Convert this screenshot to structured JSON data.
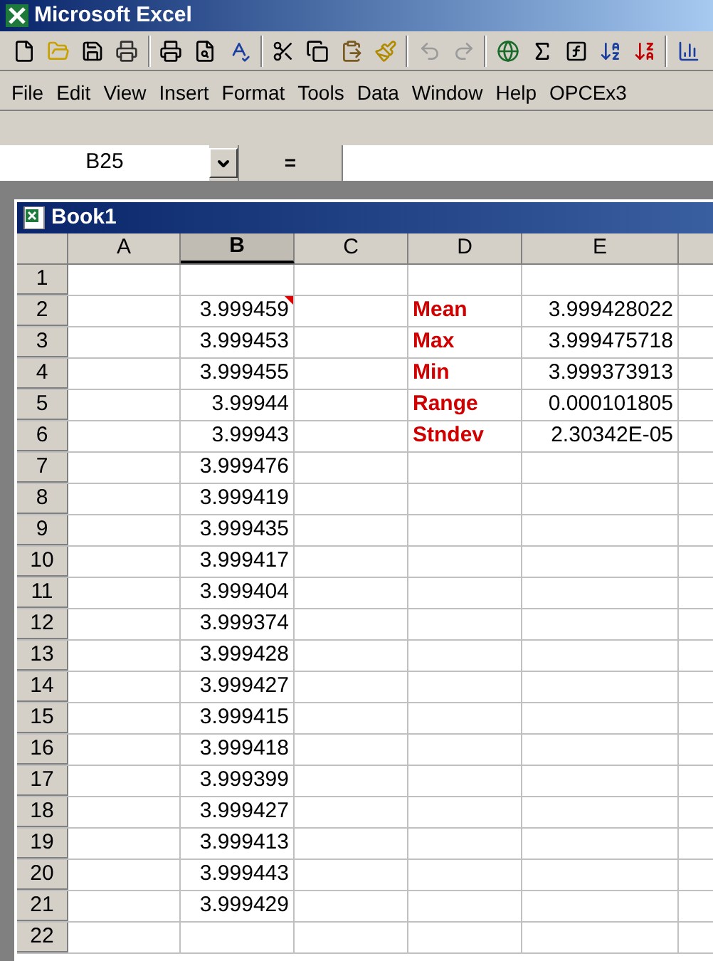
{
  "window": {
    "title": "Microsoft Excel"
  },
  "toolbar": [
    {
      "kind": "new",
      "disabled": false
    },
    {
      "kind": "open",
      "disabled": false
    },
    {
      "kind": "save",
      "disabled": false
    },
    {
      "kind": "print-file",
      "disabled": false
    },
    {
      "kind": "sep"
    },
    {
      "kind": "print",
      "disabled": false
    },
    {
      "kind": "preview",
      "disabled": false
    },
    {
      "kind": "spell",
      "disabled": false
    },
    {
      "kind": "sep"
    },
    {
      "kind": "cut",
      "disabled": false
    },
    {
      "kind": "copy",
      "disabled": false
    },
    {
      "kind": "paste",
      "disabled": false
    },
    {
      "kind": "brush",
      "disabled": false
    },
    {
      "kind": "sep"
    },
    {
      "kind": "undo",
      "disabled": true
    },
    {
      "kind": "redo",
      "disabled": true
    },
    {
      "kind": "sep"
    },
    {
      "kind": "globe",
      "disabled": false
    },
    {
      "kind": "sum",
      "disabled": false
    },
    {
      "kind": "function",
      "disabled": false
    },
    {
      "kind": "sort-asc",
      "disabled": false
    },
    {
      "kind": "sort-desc",
      "disabled": false
    },
    {
      "kind": "sep"
    },
    {
      "kind": "chart",
      "disabled": false
    }
  ],
  "menu": [
    "File",
    "Edit",
    "View",
    "Insert",
    "Format",
    "Tools",
    "Data",
    "Window",
    "Help",
    "OPCEx3"
  ],
  "formula_bar": {
    "name_box": "B25",
    "equals": "="
  },
  "workbook": {
    "title": "Book1",
    "columns": [
      {
        "label": "A",
        "selected": false
      },
      {
        "label": "B",
        "selected": true
      },
      {
        "label": "C",
        "selected": false
      },
      {
        "label": "D",
        "selected": false
      },
      {
        "label": "E",
        "selected": false
      }
    ],
    "rows": [
      {
        "number": "1"
      },
      {
        "number": "2",
        "b": "3.999459",
        "comment": true,
        "d": "Mean",
        "e": "3.999428022"
      },
      {
        "number": "3",
        "b": "3.999453",
        "d": "Max",
        "e": "3.999475718"
      },
      {
        "number": "4",
        "b": "3.999455",
        "d": "Min",
        "e": "3.999373913"
      },
      {
        "number": "5",
        "b": "3.99944",
        "d": "Range",
        "e": "0.000101805"
      },
      {
        "number": "6",
        "b": "3.99943",
        "d": "Stndev",
        "e": "2.30342E-05"
      },
      {
        "number": "7",
        "b": "3.999476"
      },
      {
        "number": "8",
        "b": "3.999419"
      },
      {
        "number": "9",
        "b": "3.999435"
      },
      {
        "number": "10",
        "b": "3.999417"
      },
      {
        "number": "11",
        "b": "3.999404"
      },
      {
        "number": "12",
        "b": "3.999374"
      },
      {
        "number": "13",
        "b": "3.999428"
      },
      {
        "number": "14",
        "b": "3.999427"
      },
      {
        "number": "15",
        "b": "3.999415"
      },
      {
        "number": "16",
        "b": "3.999418"
      },
      {
        "number": "17",
        "b": "3.999399"
      },
      {
        "number": "18",
        "b": "3.999427"
      },
      {
        "number": "19",
        "b": "3.999413"
      },
      {
        "number": "20",
        "b": "3.999443"
      },
      {
        "number": "21",
        "b": "3.999429"
      },
      {
        "number": "22"
      }
    ]
  }
}
